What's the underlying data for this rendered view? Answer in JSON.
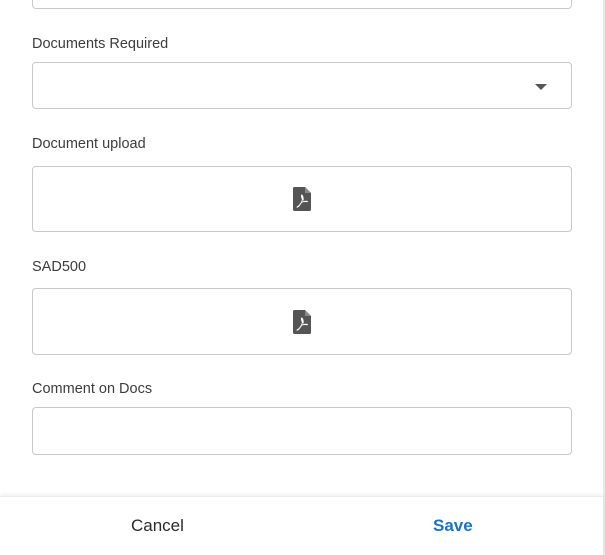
{
  "form": {
    "documents_required": {
      "label": "Documents Required",
      "value": "",
      "icon": "chevron-down-icon"
    },
    "document_upload": {
      "label": "Document upload",
      "icon": "pdf-file-icon"
    },
    "sad500": {
      "label": "SAD500",
      "icon": "pdf-file-icon"
    },
    "comment_on_docs": {
      "label": "Comment on Docs",
      "value": "",
      "placeholder": ""
    }
  },
  "footer": {
    "cancel_label": "Cancel",
    "save_label": "Save"
  },
  "colors": {
    "accent": "#1a73c9",
    "border": "#c9c9c9",
    "icon": "#555555"
  }
}
